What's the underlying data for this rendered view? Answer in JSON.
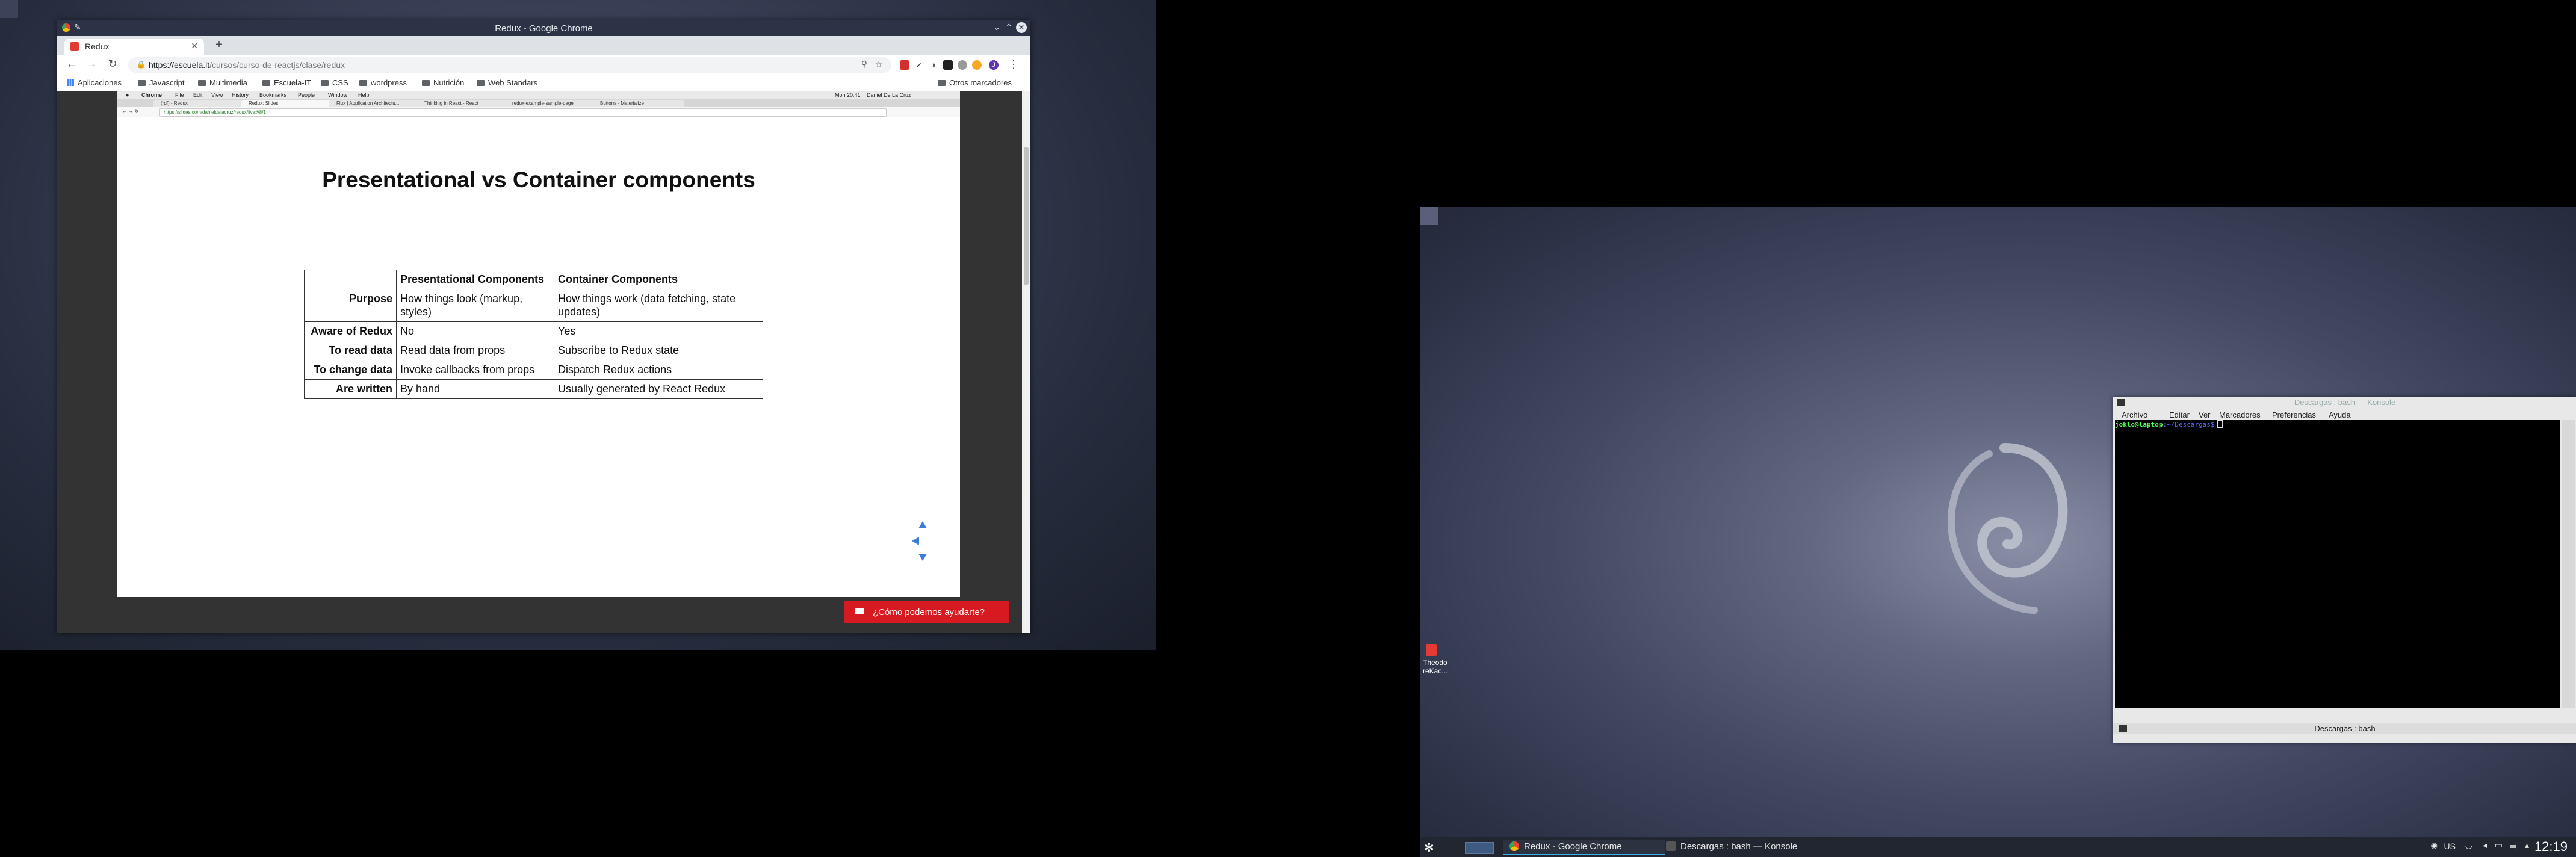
{
  "chrome": {
    "window_title": "Redux - Google Chrome",
    "tab_label": "Redux",
    "url_host": "https://escuela.it",
    "url_path": "/cursos/curso-de-reactjs/clase/redux",
    "bookmarks": [
      "Aplicaciones",
      "Javascript",
      "Multimedia",
      "Escuela-IT",
      "CSS",
      "wordpress",
      "Nutrición",
      "Web Standars"
    ],
    "other_bookmarks": "Otros marcadores"
  },
  "embedded_browser": {
    "menu": [
      "Chrome",
      "File",
      "Edit",
      "View",
      "History",
      "Bookmarks",
      "People",
      "Window",
      "Help"
    ],
    "clock": "Mon 20:41",
    "user": "Daniel De La Cruz",
    "tabs": [
      "(rdf) - Redux",
      "Redux: Slides",
      "Flux | Application Architectu...",
      "Thinking in React - React",
      "redux-example-sample-page",
      "Buttons - Materialize"
    ],
    "url": "https://slides.com/danieldelacruz/redux/live#/8/1"
  },
  "slide": {
    "title": "Presentational vs Container components",
    "table": {
      "headers": [
        "",
        "Presentational Components",
        "Container Components"
      ],
      "rows": [
        [
          "Purpose",
          "How things look (markup, styles)",
          "How things work (data fetching, state updates)"
        ],
        [
          "Aware of Redux",
          "No",
          "Yes"
        ],
        [
          "To read data",
          "Read data from props",
          "Subscribe to Redux state"
        ],
        [
          "To change data",
          "Invoke callbacks from props",
          "Dispatch Redux actions"
        ],
        [
          "Are written",
          "By hand",
          "Usually generated by React Redux"
        ]
      ]
    }
  },
  "help_button": "¿Cómo podemos ayudarte?",
  "desktop_icon": "Theodo reKac...",
  "konsole": {
    "title": "Descargas : bash — Konsole",
    "menu": [
      "Archivo",
      "Editar",
      "Ver",
      "Marcadores",
      "Preferencias",
      "Ayuda"
    ],
    "prompt_user": "joklo@laptop",
    "prompt_path": ":~/Descargas$",
    "tab_label": "Descargas : bash"
  },
  "taskbar": {
    "tasks": [
      "Redux - Google Chrome",
      "Descargas : bash — Konsole"
    ],
    "keyboard_layout": "US",
    "clock": "12:19"
  },
  "colors": {
    "chrome_frame": "#2c3346",
    "help_red": "#d71920",
    "panel": "#222630"
  }
}
